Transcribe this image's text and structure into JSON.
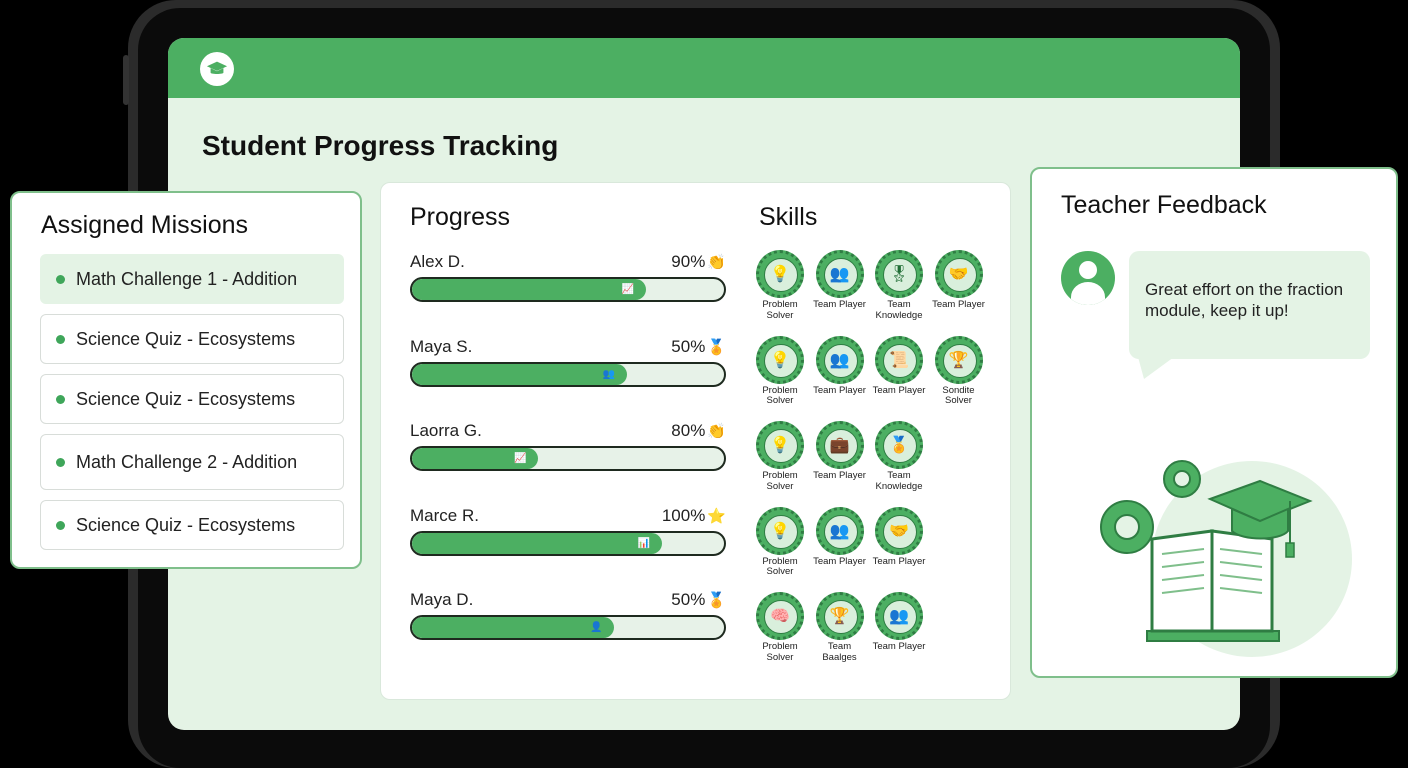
{
  "page_title": "Student Progress Tracking",
  "missions": {
    "title": "Assigned Missions",
    "items": [
      {
        "label": "Math Challenge 1 - Addition"
      },
      {
        "label": "Science Quiz - Ecosystems"
      },
      {
        "label": "Science Quiz - Ecosystems"
      },
      {
        "label": "Math Challenge 2 - Addition"
      },
      {
        "label": "Science Quiz - Ecosystems"
      }
    ]
  },
  "progress": {
    "title": "Progress",
    "students": [
      {
        "name": "Alex D.",
        "percent_label": "90%",
        "emoji": "👏",
        "fill_fraction": 0.74
      },
      {
        "name": "Maya S.",
        "percent_label": "50%",
        "emoji": "🏅",
        "fill_fraction": 0.68
      },
      {
        "name": "Laorra G.",
        "percent_label": "80%",
        "emoji": "👏",
        "fill_fraction": 0.4
      },
      {
        "name": "Marce R.",
        "percent_label": "100%",
        "emoji": "⭐",
        "fill_fraction": 0.79
      },
      {
        "name": "Maya D.",
        "percent_label": "50%",
        "emoji": "🏅",
        "fill_fraction": 0.64
      }
    ]
  },
  "skills": {
    "title": "Skills",
    "rows": [
      [
        {
          "label": "Problem Solver",
          "icon": "lightbulb-icon"
        },
        {
          "label": "Team Player",
          "icon": "team-icon"
        },
        {
          "label": "Team Knowledge",
          "icon": "medal-icon"
        },
        {
          "label": "Team Player",
          "icon": "handshake-icon"
        }
      ],
      [
        {
          "label": "Problem Solver",
          "icon": "lightbulb-icon"
        },
        {
          "label": "Team Player",
          "icon": "team-icon"
        },
        {
          "label": "Team Player",
          "icon": "certificate-icon"
        },
        {
          "label": "Sondite Solver",
          "icon": "trophy-icon"
        }
      ],
      [
        {
          "label": "Problem Solver",
          "icon": "lightbulb-icon"
        },
        {
          "label": "Team Player",
          "icon": "briefcase-icon"
        },
        {
          "label": "Team Knowledge",
          "icon": "award-icon"
        }
      ],
      [
        {
          "label": "Problem Solver",
          "icon": "lightbulb-icon"
        },
        {
          "label": "Team Player",
          "icon": "team-icon"
        },
        {
          "label": "Team Player",
          "icon": "handshake-icon"
        }
      ],
      [
        {
          "label": "Problem Solver",
          "icon": "head-icon"
        },
        {
          "label": "Team Baalges",
          "icon": "trophy-icon"
        },
        {
          "label": "Team Player",
          "icon": "team-icon"
        }
      ]
    ]
  },
  "feedback": {
    "title": "Teacher Feedback",
    "message": "Great effort on the fraction module, keep it up!"
  },
  "colors": {
    "accent": "#4caf62",
    "light": "#e4f3e5",
    "dark_green": "#2f7d43"
  }
}
